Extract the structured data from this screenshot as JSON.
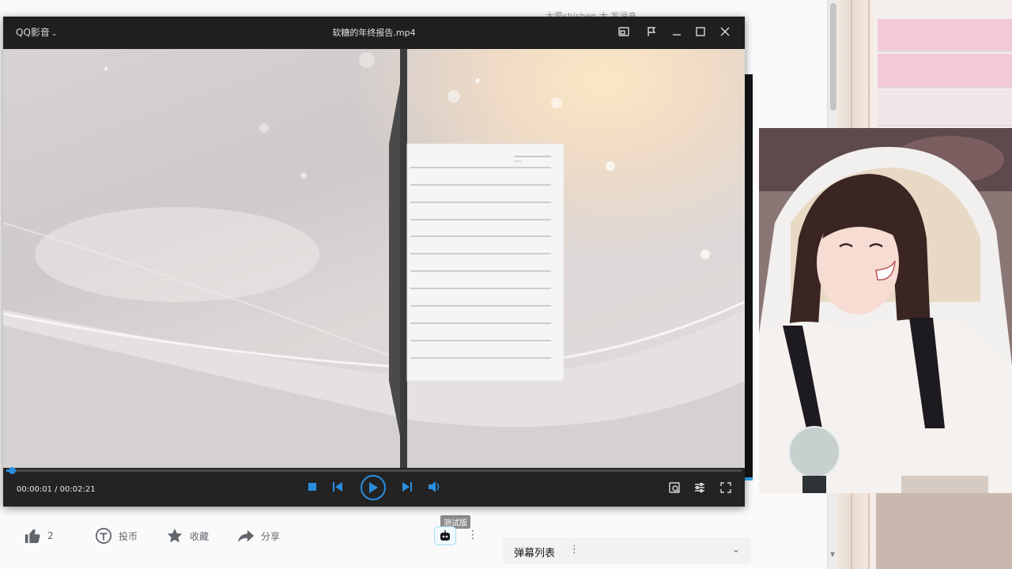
{
  "background_page": {
    "header_text": "大霸shishen 大   发消息",
    "actions": [
      {
        "label": "2",
        "icon": "thumbs-up-icon"
      },
      {
        "label": "投币",
        "icon": "coin-icon"
      },
      {
        "label": "收藏",
        "icon": "star-icon"
      },
      {
        "label": "分享",
        "icon": "share-icon"
      }
    ],
    "beta_badge": "测试版",
    "danmaku_panel": {
      "title": "弹幕列表",
      "menu": "⋮",
      "chevron": "⌄"
    }
  },
  "player": {
    "app_name": "QQ影音",
    "file_title": "软糖的年终报告.mp4",
    "current_time": "00:00:01",
    "total_time": "00:02:21",
    "time_display": "00:00:01 / 00:02:21",
    "progress": 0.007,
    "accent_color": "#2a8ee0"
  }
}
